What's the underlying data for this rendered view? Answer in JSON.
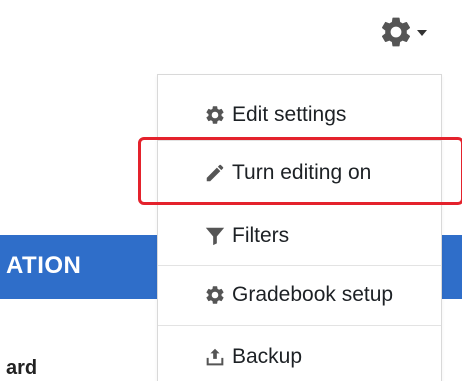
{
  "menu": {
    "items": [
      {
        "label": "Edit settings",
        "icon": "gear-icon"
      },
      {
        "label": "Turn editing on",
        "icon": "pencil-icon"
      },
      {
        "label": "Filters",
        "icon": "filter-icon"
      },
      {
        "label": "Gradebook setup",
        "icon": "gear-icon"
      },
      {
        "label": "Backup",
        "icon": "upload-icon"
      }
    ]
  },
  "banner": {
    "text": "ATION"
  },
  "left": {
    "text": "ard"
  },
  "colors": {
    "banner": "#2f6ec9",
    "highlight": "#e4222c",
    "icon": "#555555"
  }
}
